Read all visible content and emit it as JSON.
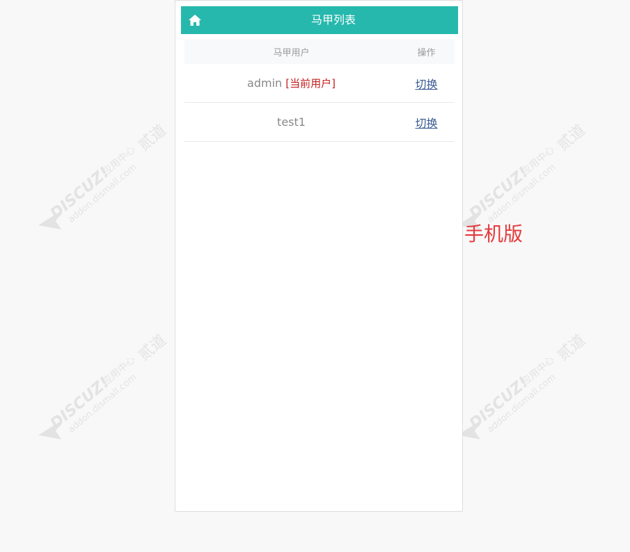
{
  "header": {
    "title": "马甲列表",
    "home_icon": "home-icon"
  },
  "table": {
    "columns": [
      "马甲用户",
      "操作"
    ],
    "rows": [
      {
        "user": "admin",
        "tag": "[当前用户]",
        "action": "切换"
      },
      {
        "user": "test1",
        "tag": "",
        "action": "切换"
      }
    ]
  },
  "side_label": "手机版",
  "watermark": {
    "brand": "DISCUZ!",
    "suffix": "应用中心",
    "url": "addon.dismall.com",
    "mark": "贰道"
  },
  "colors": {
    "header_bg": "#26b8ad",
    "current_tag": "#c41d1d",
    "link": "#3a5a92",
    "side_label": "#e4393c"
  }
}
